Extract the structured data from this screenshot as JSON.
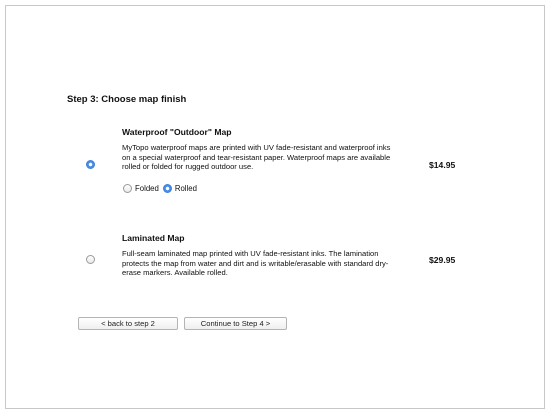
{
  "step": {
    "title": "Step 3: Choose map finish"
  },
  "options": [
    {
      "title": "Waterproof \"Outdoor\" Map",
      "description": "MyTopo waterproof maps are printed with UV fade-resistant and waterproof inks on a special waterproof and tear-resistant paper. Waterproof maps are available rolled or folded for rugged outdoor use.",
      "price": "$14.95",
      "selected": true,
      "sub_options": [
        {
          "label": "Folded",
          "selected": false
        },
        {
          "label": "Rolled",
          "selected": true
        }
      ]
    },
    {
      "title": "Laminated Map",
      "description": "Full-seam laminated map printed with UV fade-resistant inks. The lamination protects the map from water and dirt and is writable/erasable with standard dry-erase markers. Available rolled.",
      "price": "$29.95",
      "selected": false
    }
  ],
  "buttons": {
    "back_label": "< back to step 2",
    "continue_label": "Continue to Step 4 >"
  },
  "colors": {
    "radio_selected": "#4a8ee8",
    "border": "#c8c8c8"
  }
}
